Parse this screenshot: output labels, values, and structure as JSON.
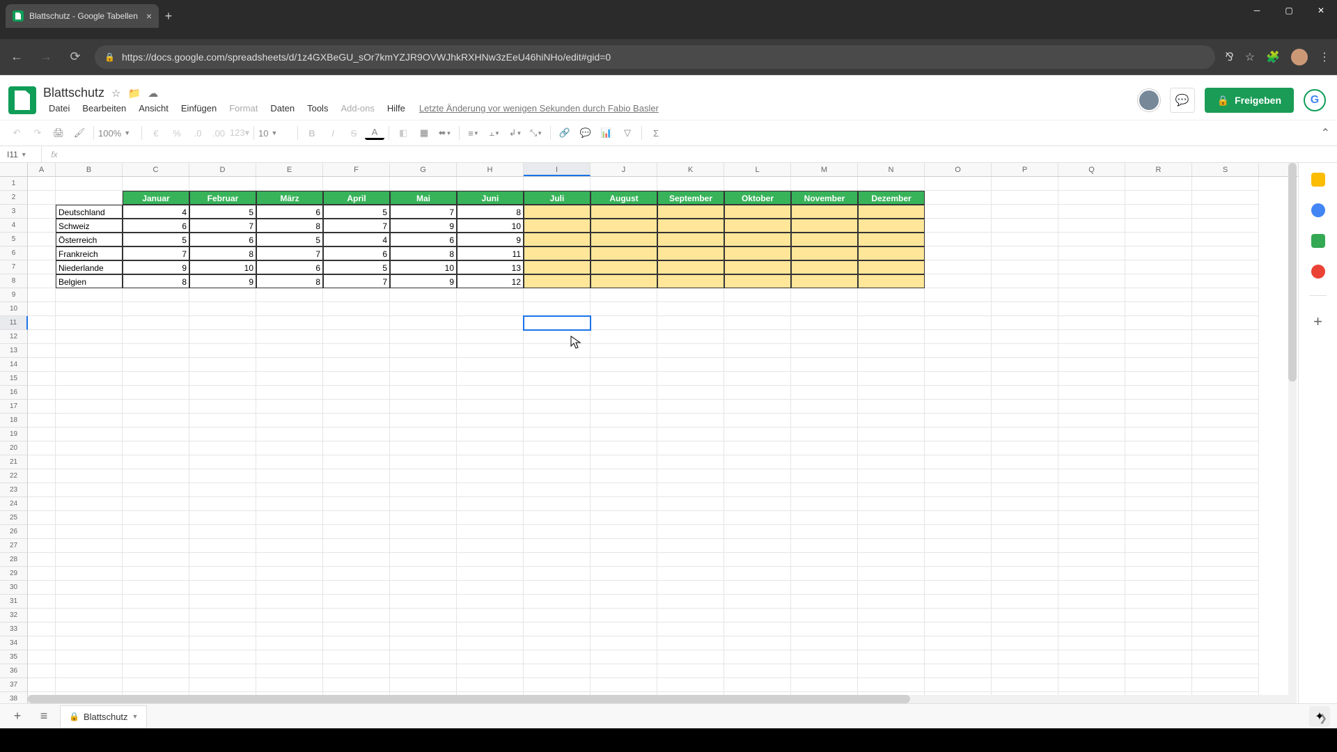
{
  "browser": {
    "tab_title": "Blattschutz - Google Tabellen",
    "url": "https://docs.google.com/spreadsheets/d/1z4GXBeGU_sOr7kmYZJR9OVWJhkRXHNw3zEeU46hiNHo/edit#gid=0"
  },
  "doc": {
    "title": "Blattschutz",
    "last_edit": "Letzte Änderung vor wenigen Sekunden durch Fabio Basler",
    "share_label": "Freigeben"
  },
  "menus": [
    "Datei",
    "Bearbeiten",
    "Ansicht",
    "Einfügen",
    "Format",
    "Daten",
    "Tools",
    "Add-ons",
    "Hilfe"
  ],
  "toolbar": {
    "zoom": "100%",
    "font_size": "10"
  },
  "name_box": "I11",
  "columns": [
    "A",
    "B",
    "C",
    "D",
    "E",
    "F",
    "G",
    "H",
    "I",
    "J",
    "K",
    "L",
    "M",
    "N",
    "O",
    "P",
    "Q",
    "R",
    "S"
  ],
  "col_widths": {
    "A": 40,
    "default": 96
  },
  "sheet_tab": "Blattschutz",
  "chart_data": {
    "type": "table",
    "title": "",
    "months": [
      "Januar",
      "Februar",
      "März",
      "April",
      "Mai",
      "Juni",
      "Juli",
      "August",
      "September",
      "Oktober",
      "November",
      "Dezember"
    ],
    "countries": [
      "Deutschland",
      "Schweiz",
      "Österreich",
      "Frankreich",
      "Niederlande",
      "Belgien"
    ],
    "values": [
      [
        4,
        5,
        6,
        5,
        7,
        8,
        null,
        null,
        null,
        null,
        null,
        null
      ],
      [
        6,
        7,
        8,
        7,
        9,
        10,
        null,
        null,
        null,
        null,
        null,
        null
      ],
      [
        5,
        6,
        5,
        4,
        6,
        9,
        null,
        null,
        null,
        null,
        null,
        null
      ],
      [
        7,
        8,
        7,
        6,
        8,
        11,
        null,
        null,
        null,
        null,
        null,
        null
      ],
      [
        9,
        10,
        6,
        5,
        10,
        13,
        null,
        null,
        null,
        null,
        null,
        null
      ],
      [
        8,
        9,
        8,
        7,
        9,
        12,
        null,
        null,
        null,
        null,
        null,
        null
      ]
    ]
  },
  "selected_cell": {
    "col": "I",
    "row": 11
  }
}
